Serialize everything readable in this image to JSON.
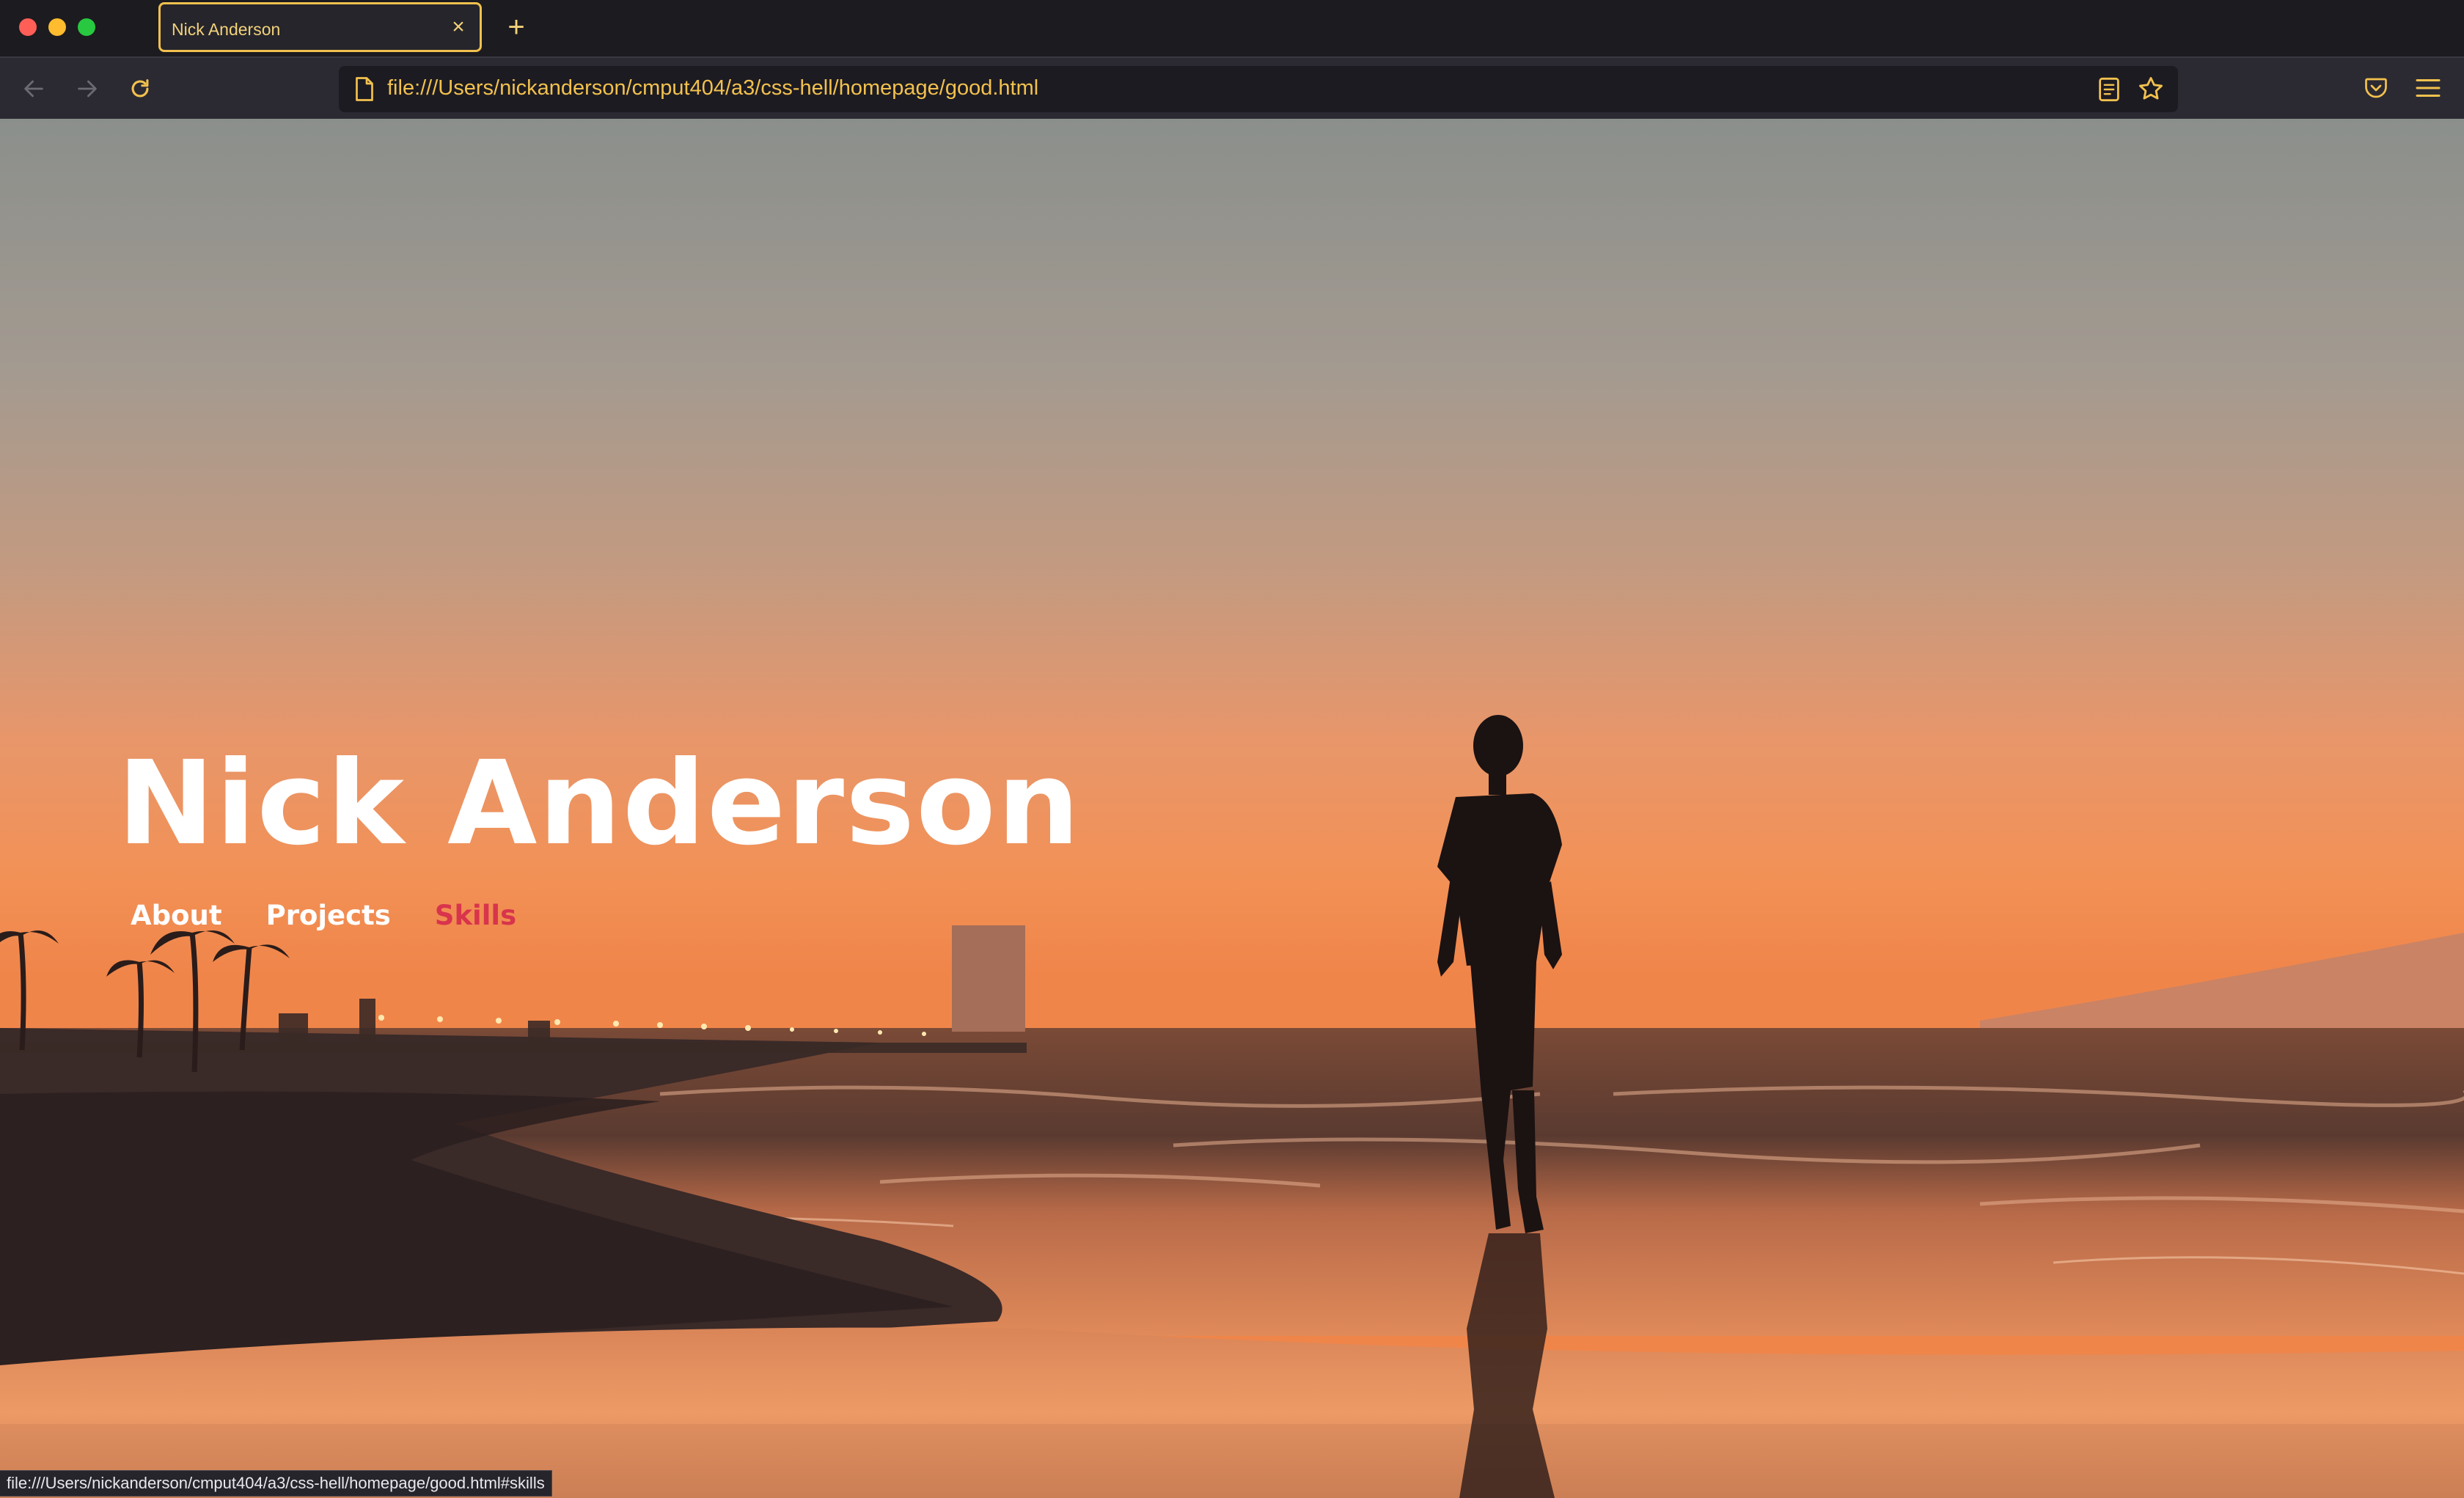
{
  "browser": {
    "tab_title": "Nick Anderson",
    "url": "file:///Users/nickanderson/cmput404/a3/css-hell/homepage/good.html",
    "status_url": "file:///Users/nickanderson/cmput404/a3/css-hell/homepage/good.html#skills",
    "accent_color": "#f2c14e"
  },
  "page": {
    "name": "Nick Anderson",
    "nav": [
      {
        "label": "About",
        "active": false
      },
      {
        "label": "Projects",
        "active": false
      },
      {
        "label": "Skills",
        "active": true
      }
    ],
    "active_link_color": "#d8344c"
  }
}
